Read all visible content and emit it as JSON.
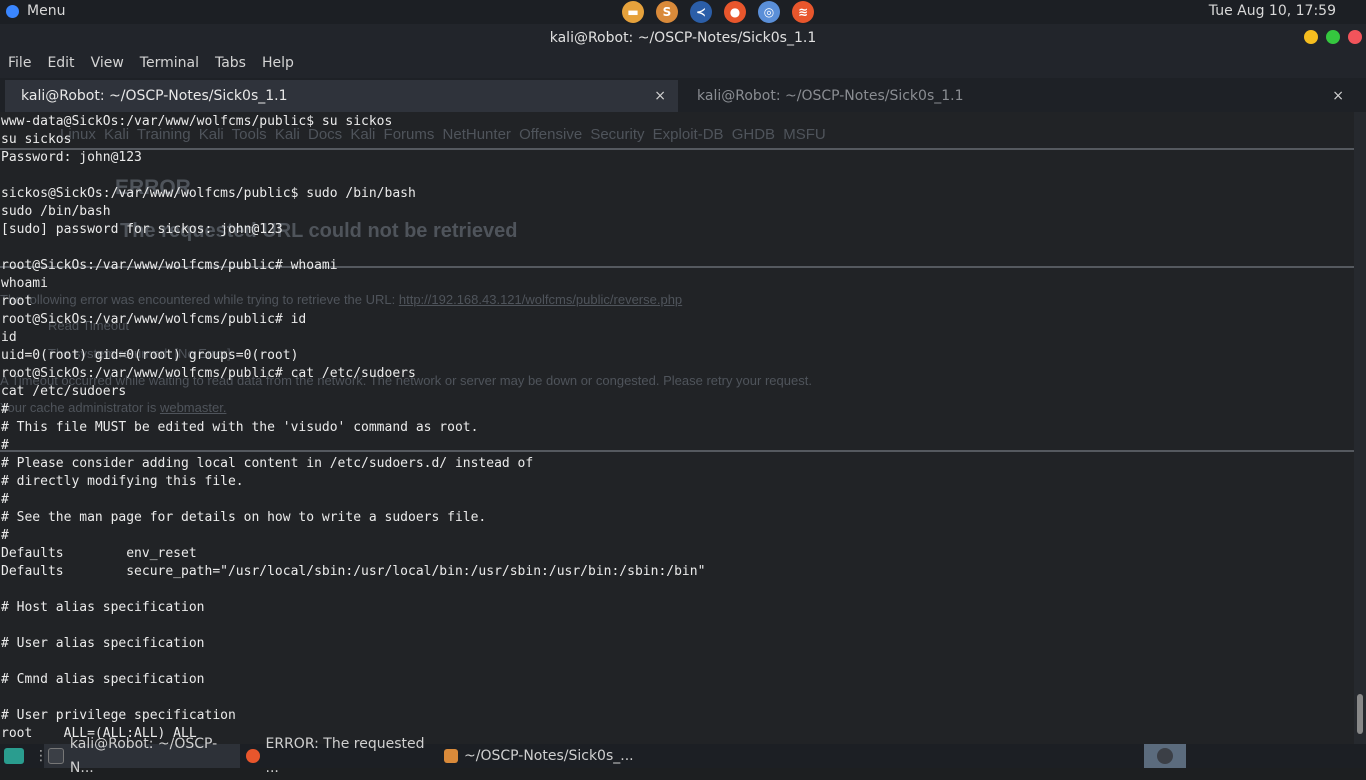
{
  "top_panel": {
    "menu_label": "Menu",
    "launchers": [
      {
        "name": "files-icon",
        "color": "#e6a23c",
        "glyph": "▬"
      },
      {
        "name": "sublime-icon",
        "color": "#d98a3a",
        "glyph": "S"
      },
      {
        "name": "vscode-icon",
        "color": "#2b5ea8",
        "glyph": "≺"
      },
      {
        "name": "firefox-icon",
        "color": "#e8562c",
        "glyph": "●"
      },
      {
        "name": "chromium-icon",
        "color": "#5a8fd8",
        "glyph": "◎"
      },
      {
        "name": "burp-icon",
        "color": "#e8562c",
        "glyph": "≋"
      }
    ],
    "clock": "Tue Aug 10, 17:59"
  },
  "window": {
    "title": "kali@Robot: ~/OSCP-Notes/Sick0s_1.1",
    "menu": [
      "File",
      "Edit",
      "View",
      "Terminal",
      "Tabs",
      "Help"
    ],
    "tabs": [
      {
        "label": "kali@Robot: ~/OSCP-Notes/Sick0s_1.1",
        "active": true
      },
      {
        "label": "kali@Robot: ~/OSCP-Notes/Sick0s_1.1",
        "active": false
      }
    ],
    "close_glyph": "×"
  },
  "ghost_page": {
    "nav": "Linux  Kali Training  Kali Tools  Kali Docs  Kali Forums  NetHunter  Offensive Security  Exploit-DB  GHDB  MSFU",
    "error_heading": "ERROR",
    "subheading": "The requested URL could not be retrieved",
    "error_intro": "The following error was encountered while trying to retrieve the URL:",
    "error_url": "http://192.168.43.121/wolfcms/public/reverse.php",
    "read_timeout": "Read Timeout",
    "system_returned": "The system returned: [No Error]",
    "timeout_text": "A Timeout occurred while waiting to read data from the network. The network or server may be down or congested. Please retry your request.",
    "cache_admin": "Your cache administrator is",
    "cache_admin_link": "webmaster."
  },
  "terminal_lines": [
    "www-data@SickOs:/var/www/wolfcms/public$ su sickos",
    "su sickos",
    "Password: john@123",
    "",
    "sickos@SickOs:/var/www/wolfcms/public$ sudo /bin/bash",
    "sudo /bin/bash",
    "[sudo] password for sickos: john@123",
    "",
    "root@SickOs:/var/www/wolfcms/public# whoami",
    "whoami",
    "root",
    "root@SickOs:/var/www/wolfcms/public# id",
    "id",
    "uid=0(root) gid=0(root) groups=0(root)",
    "root@SickOs:/var/www/wolfcms/public# cat /etc/sudoers",
    "cat /etc/sudoers",
    "#",
    "# This file MUST be edited with the 'visudo' command as root.",
    "#",
    "# Please consider adding local content in /etc/sudoers.d/ instead of",
    "# directly modifying this file.",
    "#",
    "# See the man page for details on how to write a sudoers file.",
    "#",
    "Defaults        env_reset",
    "Defaults        secure_path=\"/usr/local/sbin:/usr/local/bin:/usr/sbin:/usr/bin:/sbin:/bin\"",
    "",
    "# Host alias specification",
    "",
    "# User alias specification",
    "",
    "# Cmnd alias specification",
    "",
    "# User privilege specification",
    "root    ALL=(ALL:ALL) ALL"
  ],
  "taskbar": {
    "items": [
      {
        "label": "kali@Robot: ~/OSCP-N...",
        "icon_color": "#3b3f46",
        "active": true
      },
      {
        "label": "ERROR: The requested ...",
        "icon_color": "#e8562c",
        "active": false
      },
      {
        "label": "~/OSCP-Notes/Sick0s_...",
        "icon_color": "#d98a3a",
        "active": false
      }
    ]
  }
}
